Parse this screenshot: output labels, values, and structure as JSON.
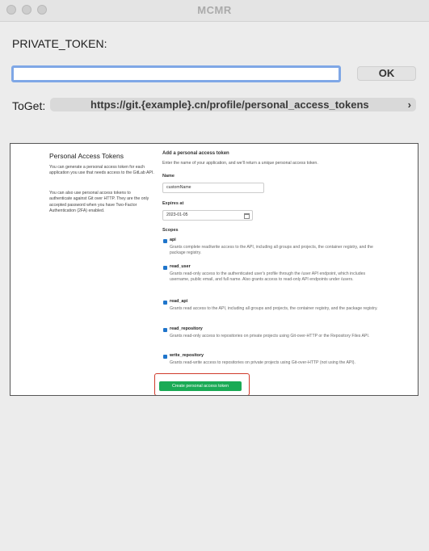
{
  "window": {
    "title": "MCMR"
  },
  "form": {
    "token_label": "PRIVATE_TOKEN:",
    "token_value": "",
    "ok_label": "OK",
    "toget_label": "ToGet:",
    "url": "https://git.{example}.cn/profile/personal_access_tokens",
    "url_chevron": "›"
  },
  "gitlab": {
    "section_title": "Personal Access Tokens",
    "section_desc_1": "You can generate a personal access token for each application you use that needs access to the GitLab API.",
    "section_desc_2": "You can also use personal access tokens to authenticate against Git over HTTP. They are the only accepted password when you have Two-Factor Authentication (2FA) enabled.",
    "add_heading": "Add a personal access token",
    "add_intro": "Enter the name of your application, and we'll return a unique personal access token.",
    "name_label": "Name",
    "name_value": "customName",
    "expires_label": "Expires at",
    "expires_value": "2023-01-05",
    "scopes_label": "Scopes",
    "scopes": [
      {
        "name": "api",
        "desc": "Grants complete read/write access to the API, including all groups and projects, the container registry, and the package registry."
      },
      {
        "name": "read_user",
        "desc": "Grants read-only access to the authenticated user's profile through the /user API endpoint, which includes username, public email, and full name. Also grants access to read-only API endpoints under /users."
      },
      {
        "name": "read_api",
        "desc": "Grants read access to the API, including all groups and projects, the container registry, and the package registry."
      },
      {
        "name": "read_repository",
        "desc": "Grants read-only access to repositories on private projects using Git-over-HTTP or the Repository Files API."
      },
      {
        "name": "write_repository",
        "desc": "Grants read-write access to repositories on private projects using Git-over-HTTP (not using the API)."
      }
    ],
    "create_label": "Create personal access token"
  },
  "colors": {
    "accent_focus": "#7fa7e6",
    "checkbox": "#1f75cb",
    "create_button": "#1aaa55",
    "highlight_border": "#d03a2b"
  }
}
